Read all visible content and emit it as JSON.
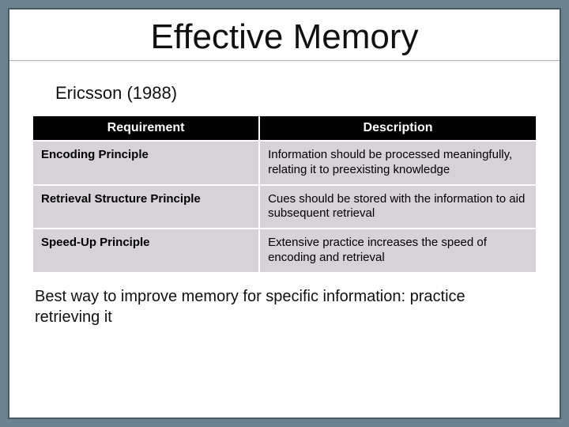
{
  "title": "Effective Memory",
  "subheading": "Ericsson (1988)",
  "table": {
    "headers": {
      "requirement": "Requirement",
      "description": "Description"
    },
    "rows": [
      {
        "requirement": "Encoding Principle",
        "description": "Information should be processed meaningfully, relating it to preexisting knowledge"
      },
      {
        "requirement": "Retrieval Structure Principle",
        "description": "Cues should be stored with the information to aid subsequent retrieval"
      },
      {
        "requirement": "Speed-Up Principle",
        "description": "Extensive practice increases the speed of encoding and retrieval"
      }
    ]
  },
  "closing": "Best way to improve memory for specific information: practice retrieving it"
}
